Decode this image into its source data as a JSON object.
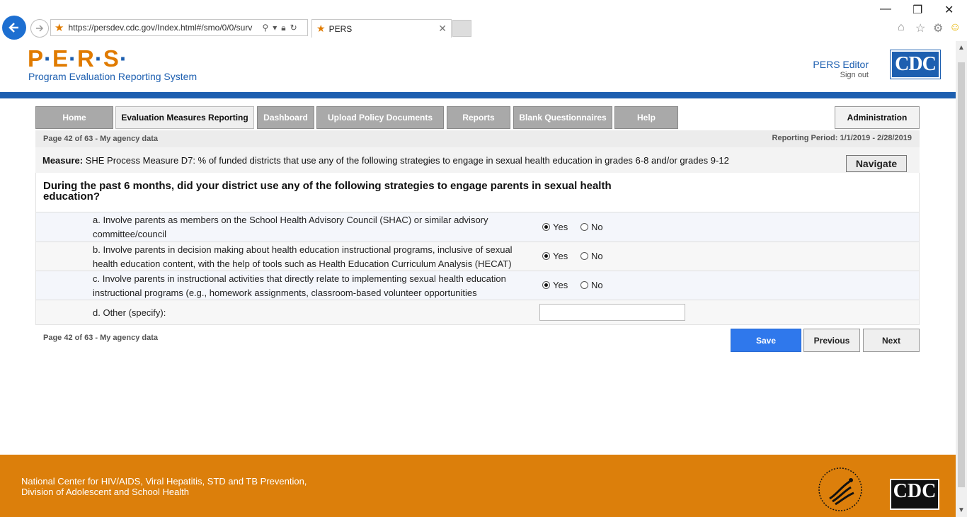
{
  "browser": {
    "url": "https://persdev.cdc.gov/Index.html#/smo/0/0/surv",
    "tab_title": "PERS"
  },
  "header": {
    "logo_text": "P·E·R·S·",
    "subtitle": "Program Evaluation Reporting System",
    "user_name": "PERS Editor",
    "sign_out": "Sign out",
    "cdc_logo": "CDC"
  },
  "nav": {
    "items": [
      {
        "label": "Home"
      },
      {
        "label": "Evaluation Measures Reporting"
      },
      {
        "label": "Dashboard"
      },
      {
        "label": "Upload Policy Documents"
      },
      {
        "label": "Reports"
      },
      {
        "label": "Blank Questionnaires"
      },
      {
        "label": "Help"
      }
    ],
    "admin": "Administration"
  },
  "info": {
    "page": "Page 42 of 63 - My agency data",
    "period": "Reporting Period: 1/1/2019 - 2/28/2019"
  },
  "measure": {
    "prefix": "Measure:",
    "text": "SHE Process Measure D7: % of funded districts that use any of the following strategies to engage in sexual health education in grades 6-8 and/or grades 9-12",
    "navigate": "Navigate"
  },
  "question": "During the past 6 months, did your district use any of the following strategies to engage parents in sexual health education?",
  "options": {
    "yes": "Yes",
    "no": "No"
  },
  "rows": [
    {
      "text": "a. Involve parents as members on the School Health Advisory Council (SHAC) or similar advisory committee/council",
      "answer": "Yes"
    },
    {
      "text": "b. Involve parents in decision making about health education instructional programs, inclusive of sexual health education content, with the help of tools such as Health Education Curriculum Analysis (HECAT)",
      "answer": "Yes"
    },
    {
      "text": "c. Involve parents in instructional activities that directly relate to implementing sexual health education instructional programs (e.g., homework assignments, classroom-based volunteer opportunities",
      "answer": "Yes"
    },
    {
      "text": "d. Other (specify):",
      "value": ""
    }
  ],
  "footer_note": "Page 42 of 63 - My agency data",
  "buttons": {
    "save": "Save",
    "previous": "Previous",
    "next": "Next"
  },
  "footer": {
    "line1": "National Center for HIV/AIDS, Viral Hepatitis, STD and TB Prevention,",
    "line2": "Division of Adolescent and School Health",
    "cdc": "CDC"
  },
  "colors": {
    "brand_blue": "#1d5fb0",
    "brand_orange": "#e07b00",
    "footer_orange": "#dc7f0b",
    "save_blue": "#2f78ec"
  }
}
